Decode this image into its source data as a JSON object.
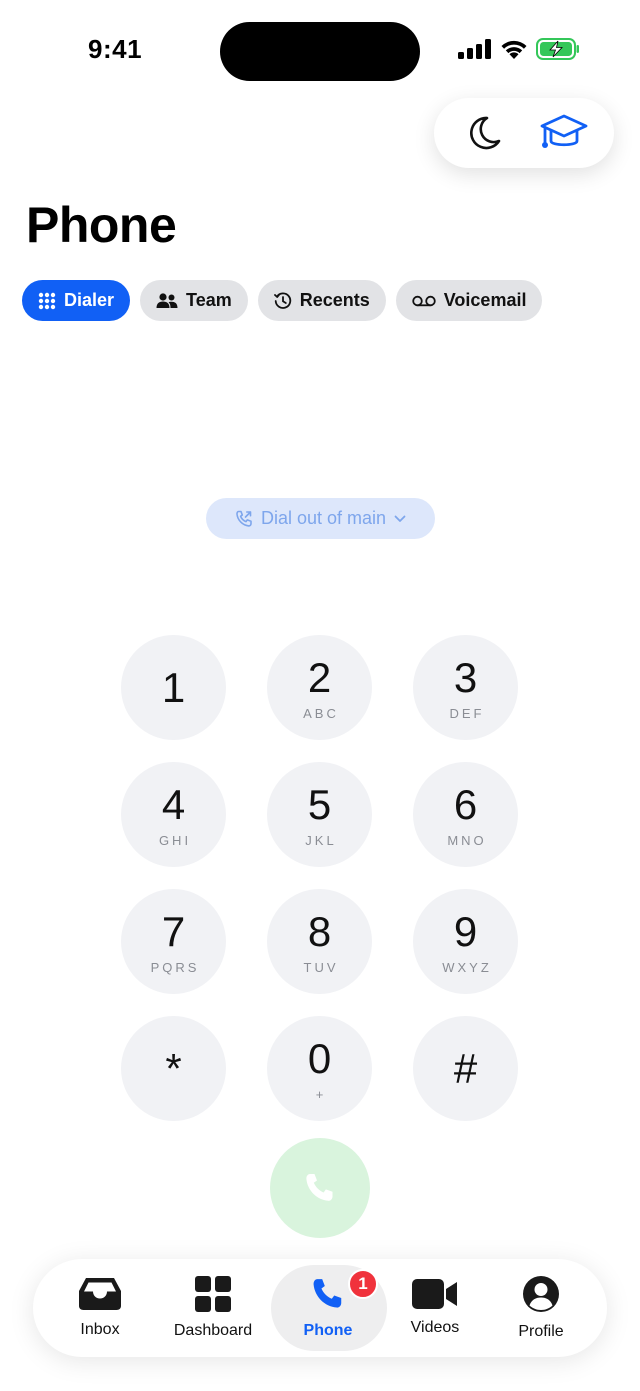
{
  "status_bar": {
    "time": "9:41"
  },
  "header": {
    "title": "Phone"
  },
  "tabs": [
    {
      "label": "Dialer",
      "icon": "keypad-grid-icon",
      "active": true
    },
    {
      "label": "Team",
      "icon": "people-icon",
      "active": false
    },
    {
      "label": "Recents",
      "icon": "history-clock-icon",
      "active": false
    },
    {
      "label": "Voicemail",
      "icon": "voicemail-icon",
      "active": false
    }
  ],
  "dial_out": {
    "label": "Dial out of main"
  },
  "keypad": [
    {
      "digit": "1",
      "letters": ""
    },
    {
      "digit": "2",
      "letters": "ABC"
    },
    {
      "digit": "3",
      "letters": "DEF"
    },
    {
      "digit": "4",
      "letters": "GHI"
    },
    {
      "digit": "5",
      "letters": "JKL"
    },
    {
      "digit": "6",
      "letters": "MNO"
    },
    {
      "digit": "7",
      "letters": "PQRS"
    },
    {
      "digit": "8",
      "letters": "TUV"
    },
    {
      "digit": "9",
      "letters": "WXYZ"
    },
    {
      "digit": "*",
      "letters": ""
    },
    {
      "digit": "0",
      "letters": "+"
    },
    {
      "digit": "#",
      "letters": ""
    }
  ],
  "bottom_nav": [
    {
      "label": "Inbox",
      "icon": "inbox-icon",
      "active": false
    },
    {
      "label": "Dashboard",
      "icon": "dashboard-grid-icon",
      "active": false
    },
    {
      "label": "Phone",
      "icon": "phone-icon",
      "active": true,
      "badge": "1"
    },
    {
      "label": "Videos",
      "icon": "video-camera-icon",
      "active": false
    },
    {
      "label": "Profile",
      "icon": "profile-icon",
      "active": false
    }
  ],
  "colors": {
    "accent": "#1160f5",
    "badge": "#f0323c",
    "call_button": "#d9f4dd",
    "battery": "#34c759"
  }
}
